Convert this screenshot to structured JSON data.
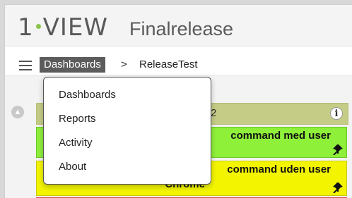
{
  "app": {
    "logo_left": "1",
    "logo_right": "VIEW",
    "project": "Finalrelease"
  },
  "breadcrumb": {
    "link": "Dashboards",
    "separator": ">",
    "current": "ReleaseTest"
  },
  "menu": {
    "items": [
      "Dashboards",
      "Reports",
      "Activity",
      "About"
    ]
  },
  "dashboard": {
    "group_count": "2",
    "cards": [
      {
        "title": "command med user",
        "color": "#8ff03a"
      },
      {
        "title": "command uden user",
        "subtitle": "Chrome",
        "color": "#f3f500"
      }
    ]
  },
  "icons": {
    "menu": "hamburger-icon",
    "info": "info-icon",
    "pin": "pin-icon",
    "collapse": "chevron-up-icon"
  }
}
